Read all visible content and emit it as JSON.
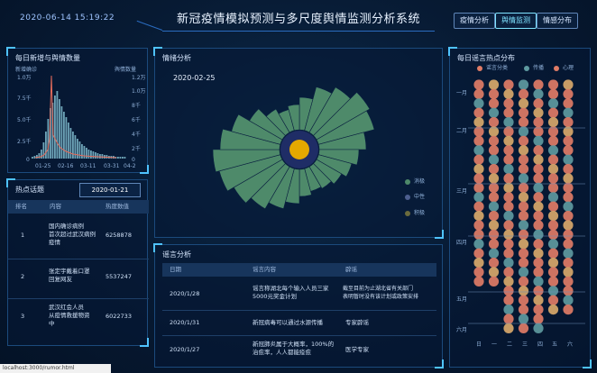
{
  "header": {
    "datetime": "2020-06-14 15:19:22",
    "title": "新冠疫情模拟预测与多尺度舆情监测分析系统",
    "nav": [
      "疫情分析",
      "舆情监测",
      "情感分布"
    ]
  },
  "daily_panel": {
    "title": "每日新增与舆情数量",
    "left_axis_label": "新增确诊",
    "right_axis_label": "舆情数量",
    "left_ticks": [
      "1.0万",
      "7.5千",
      "5.0千",
      "2.5千",
      "0"
    ],
    "right_ticks": [
      "1.2万",
      "1.0万",
      "8千",
      "6千",
      "4千",
      "2千",
      "0"
    ],
    "x_ticks": [
      "01-25",
      "02-16",
      "03-11",
      "03-31",
      "04-2"
    ]
  },
  "hot_topics": {
    "title": "热点话题",
    "date": "2020-01-21",
    "headers": [
      "排名",
      "内容",
      "热度数值"
    ],
    "rows": [
      {
        "rank": "1",
        "content": "国内确诊病例\n首次超过武汉病例\n疫情",
        "value": "6258878"
      },
      {
        "rank": "2",
        "content": "张定宇戴着口罩\n回复网友",
        "value": "5537247"
      },
      {
        "rank": "3",
        "content": "武汉红会人员\n从疫情救援物资\n中",
        "value": "6022733"
      }
    ]
  },
  "emotion_panel": {
    "title": "情绪分析",
    "date": "2020-02-25",
    "legend": [
      "消极",
      "中性",
      "积极"
    ],
    "colors": {
      "negative": "#4e8a6a",
      "neutral": "#4d5f8f",
      "positive": "#e4a800"
    }
  },
  "rumor_panel": {
    "title": "谣言分析",
    "headers": [
      "日期",
      "谣言内容",
      "辟谣"
    ],
    "rows": [
      {
        "date": "2020/1/28",
        "content": "谣言称湖北每个输入人员三家\n5000元奖金计划",
        "refute": "截至目前为止湖北省有关部门\n表明暂时没有该计划或政策安排"
      },
      {
        "date": "2020/1/31",
        "content": "新冠病毒可以通过水源传播",
        "refute": "专家辟谣"
      },
      {
        "date": "2020/1/27",
        "content": "新冠肺炎属于大概率，100%的\n治愈率，人人都能痊愈",
        "refute": "医学专家"
      }
    ]
  },
  "rumor_hotspot": {
    "title": "每日谣言热点分布",
    "legend": [
      "谣言分类",
      "传播",
      "心理"
    ],
    "y_labels": [
      "一月",
      "二月",
      "三月",
      "四月",
      "五月",
      "六月"
    ],
    "x_labels": [
      "日",
      "一",
      "二",
      "三",
      "四",
      "五",
      "六"
    ],
    "colors": [
      "#e07c66",
      "#5e9aa0",
      "#d8a86a"
    ]
  },
  "status_url": "localhost:3000/rumor.html"
}
